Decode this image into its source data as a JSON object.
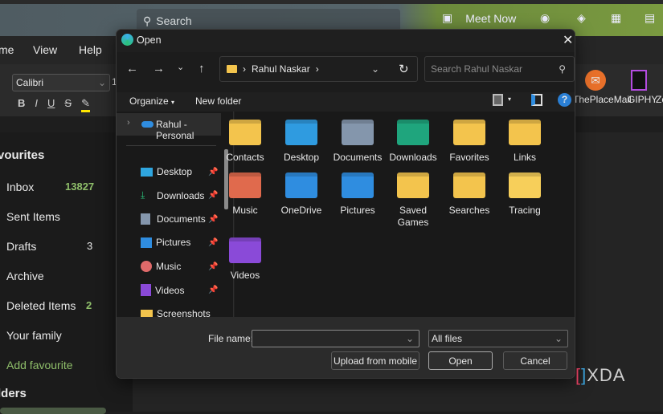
{
  "outlook": {
    "search_placeholder": "Search",
    "meet_now": "Meet Now",
    "menu": [
      "me",
      "View",
      "Help"
    ],
    "font": "Calibri",
    "font_size": "1",
    "format_buttons": [
      "B",
      "I",
      "U",
      "S"
    ],
    "addins": [
      "ThePlaceMail",
      "GIPHY",
      "Zo"
    ],
    "favourites_header": "vourites",
    "folders_header": "lders",
    "favourites": [
      {
        "label": "Inbox",
        "count": "13827"
      },
      {
        "label": "Sent Items",
        "count": ""
      },
      {
        "label": "Drafts",
        "count": "3"
      },
      {
        "label": "Archive",
        "count": ""
      },
      {
        "label": "Deleted Items",
        "count": "2"
      },
      {
        "label": "Your family",
        "count": ""
      }
    ],
    "add_favourite": "Add favourite",
    "accent": "#8fbf6a"
  },
  "dialog": {
    "title": "Open",
    "breadcrumb": "Rahul Naskar",
    "search_placeholder": "Search Rahul Naskar",
    "organize": "Organize",
    "new_folder": "New folder",
    "nav_root": "Rahul - Personal",
    "nav_items": [
      "Desktop",
      "Downloads",
      "Documents",
      "Pictures",
      "Music",
      "Videos",
      "Screenshots"
    ],
    "folders": [
      {
        "label": "Contacts",
        "color": "#f3c44d"
      },
      {
        "label": "Desktop",
        "color": "#2f9be0"
      },
      {
        "label": "Documents",
        "color": "#8496ac"
      },
      {
        "label": "Downloads",
        "color": "#1fa57d"
      },
      {
        "label": "Favorites",
        "color": "#f3c44d"
      },
      {
        "label": "Links",
        "color": "#f3c44d"
      },
      {
        "label": "Music",
        "color": "#e06a4d"
      },
      {
        "label": "OneDrive",
        "color": "#2f8de0"
      },
      {
        "label": "Pictures",
        "color": "#2f8de0"
      },
      {
        "label": "Saved Games",
        "color": "#f3c44d"
      },
      {
        "label": "Searches",
        "color": "#f3c44d"
      },
      {
        "label": "Tracing",
        "color": "#f7cf5a"
      },
      {
        "label": "Videos",
        "color": "#8a4ad8"
      }
    ],
    "file_name_label": "File name:",
    "file_name_value": "",
    "file_type": "All files",
    "upload_button": "Upload from mobile",
    "open_button": "Open",
    "cancel_button": "Cancel"
  },
  "watermark": "XDA"
}
